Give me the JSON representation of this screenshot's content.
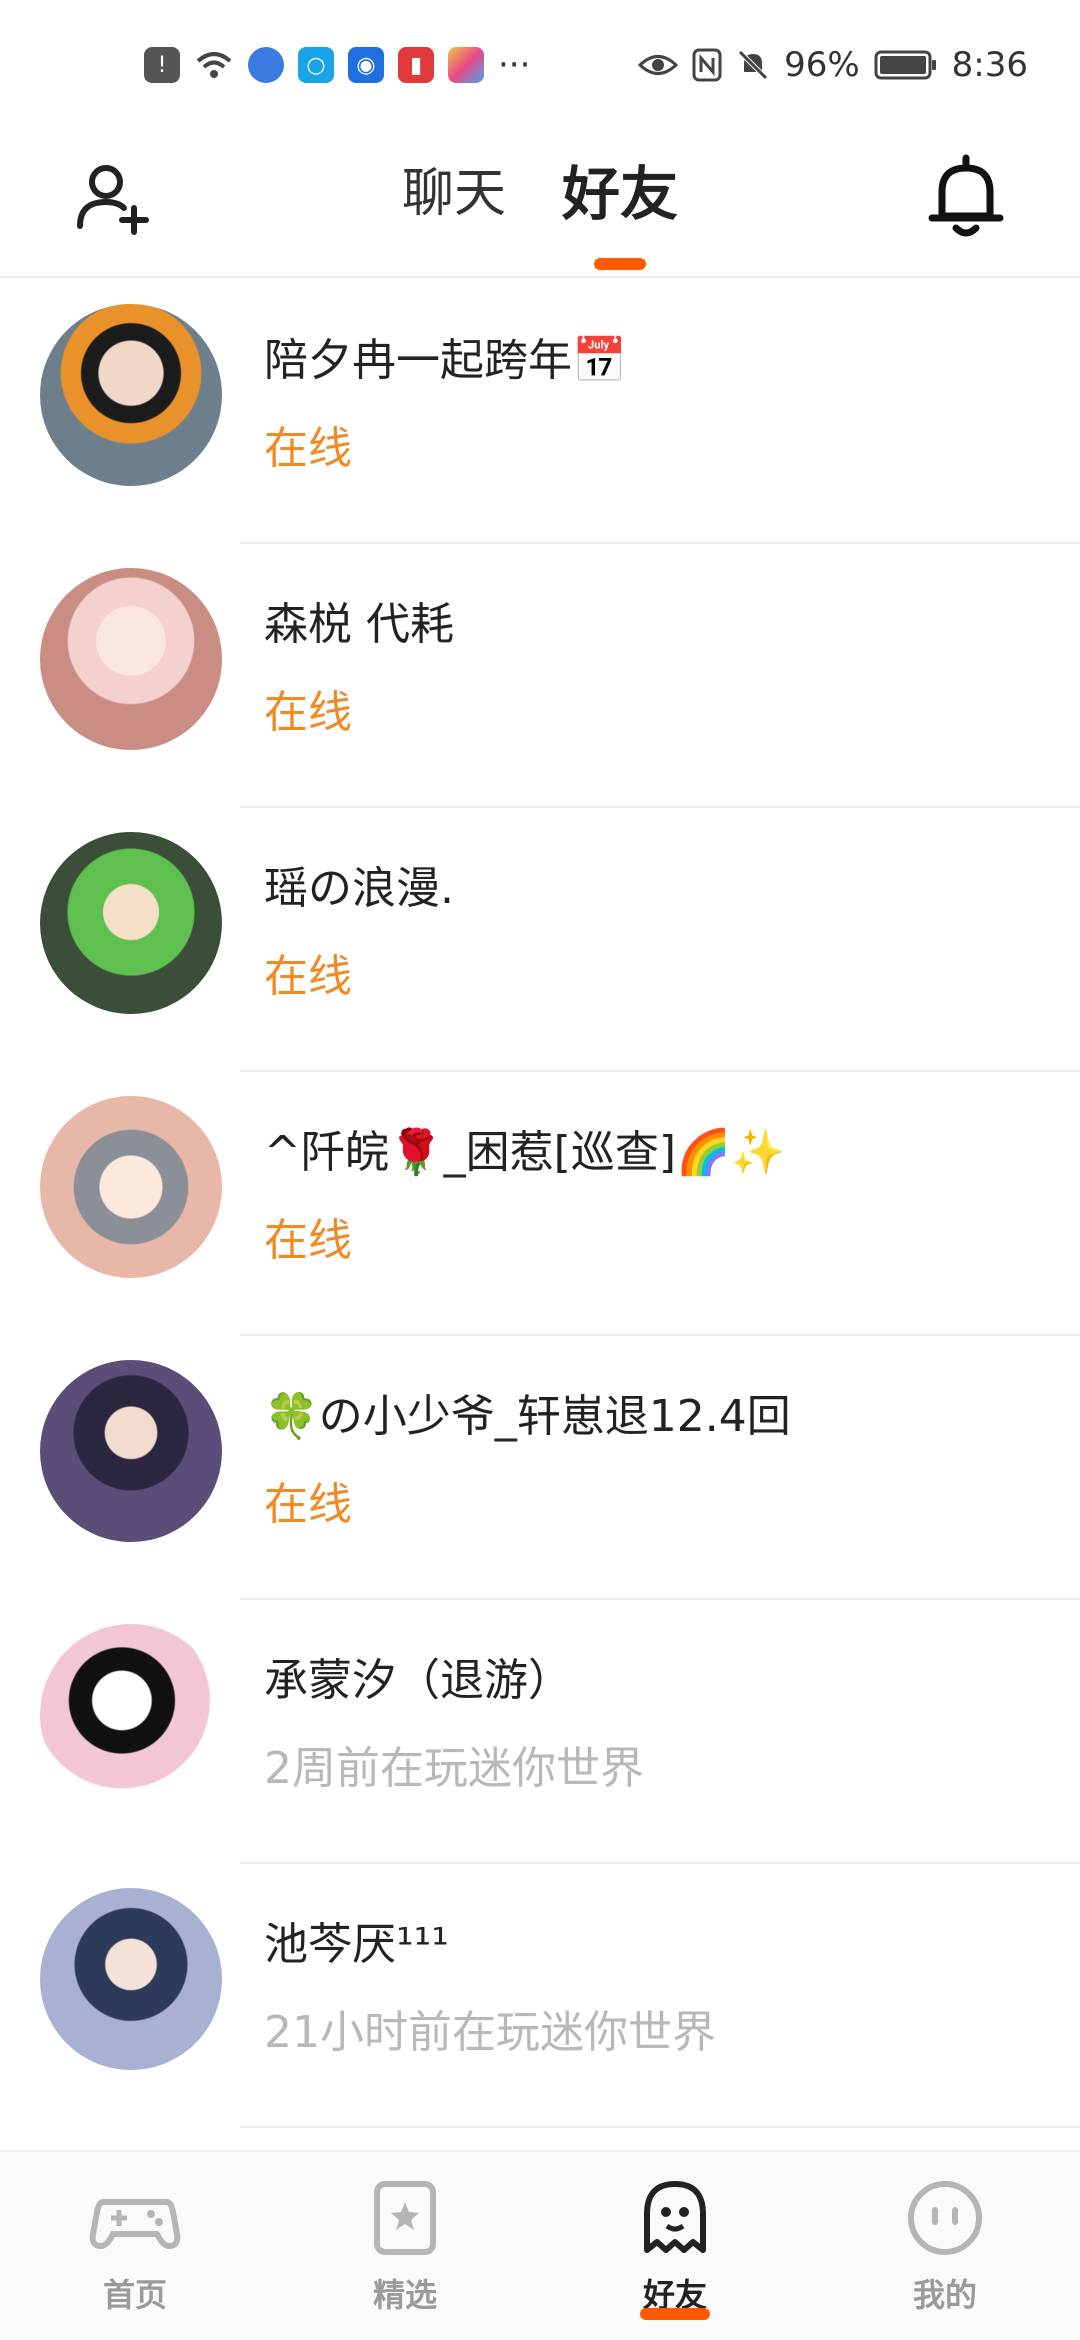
{
  "status_bar": {
    "battery_percent": "96%",
    "time": "8:36",
    "more": "···"
  },
  "header": {
    "tabs": [
      {
        "label": "聊天",
        "active": false
      },
      {
        "label": "好友",
        "active": true
      }
    ],
    "accent_color": "#ff5a00"
  },
  "friends": [
    {
      "name": "陪夕冉一起跨年📅",
      "status": "在线",
      "online": true
    },
    {
      "name": "森棁  代耗",
      "status": "在线",
      "online": true
    },
    {
      "name": "瑶の浪漫.",
      "status": "在线",
      "online": true
    },
    {
      "name": "^阡皖🌹_困惹[巡查]🌈✨",
      "status": "在线",
      "online": true
    },
    {
      "name": "🍀の小少爷_轩崽退12.4回",
      "status": "在线",
      "online": true
    },
    {
      "name": "承蒙汐（退游）",
      "status": "2周前在玩迷你世界",
      "online": false
    },
    {
      "name": "池芩厌¹¹¹",
      "status": "21小时前在玩迷你世界",
      "online": false
    }
  ],
  "bottom_nav": [
    {
      "label": "首页",
      "icon": "gamepad-icon",
      "active": false
    },
    {
      "label": "精选",
      "icon": "star-card-icon",
      "active": false
    },
    {
      "label": "好友",
      "icon": "ghost-icon",
      "active": true
    },
    {
      "label": "我的",
      "icon": "face-icon",
      "active": false
    }
  ]
}
